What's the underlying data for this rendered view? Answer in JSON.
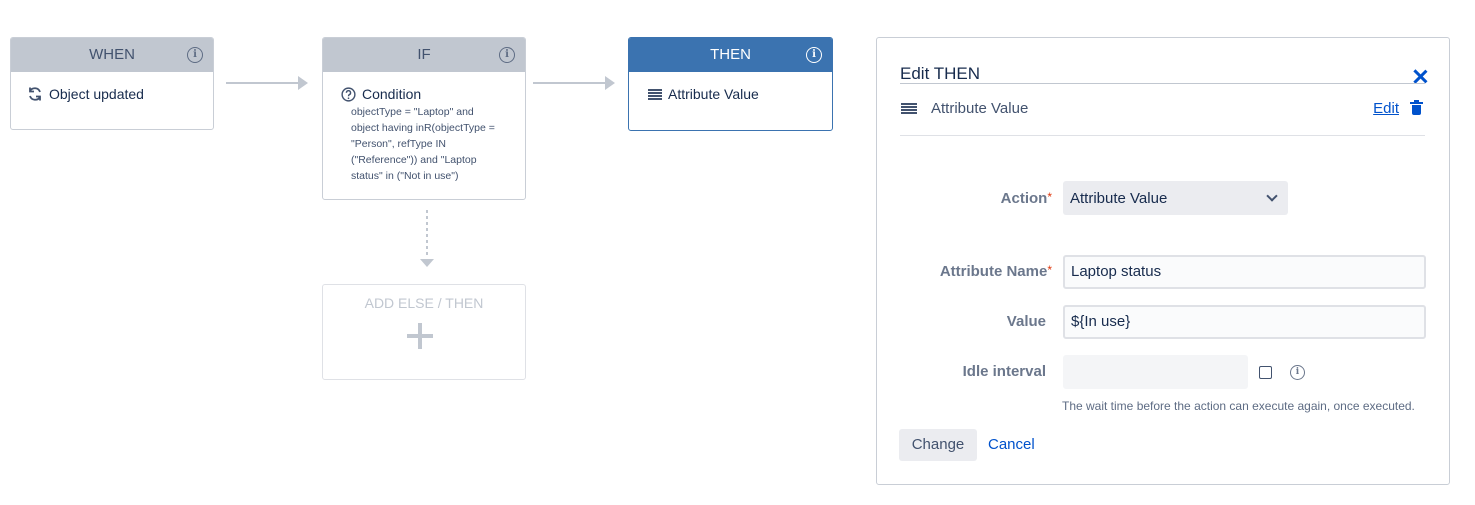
{
  "flow": {
    "when": {
      "title": "WHEN",
      "item": "Object updated"
    },
    "if": {
      "title": "IF",
      "item": "Condition",
      "condition_lines": [
        "objectType = \"Laptop\" and",
        "object having inR(objectType =",
        "\"Person\", refType IN",
        "(\"Reference\")) and \"Laptop",
        "status\" in (\"Not in use\")"
      ]
    },
    "then": {
      "title": "THEN",
      "item": "Attribute Value"
    },
    "else": {
      "label": "ADD ELSE / THEN"
    }
  },
  "panel": {
    "title": "Edit THEN",
    "attribute_row": "Attribute Value",
    "edit_label": "Edit",
    "form": {
      "action_label": "Action",
      "action_value": "Attribute Value",
      "attribute_name_label": "Attribute Name",
      "attribute_name_value": "Laptop status",
      "value_label": "Value",
      "value_value": "${In use}",
      "idle_label": "Idle interval",
      "idle_value": "",
      "helper": "The wait time before the action can execute again, once executed."
    },
    "change_label": "Change",
    "cancel_label": "Cancel"
  },
  "icons": {
    "info": "info-icon",
    "refresh": "refresh-icon",
    "question": "question-circle-icon",
    "menu": "list-icon",
    "close": "close-icon",
    "trash": "trash-icon",
    "plus": "plus-icon"
  },
  "colors": {
    "header_gray": "#c1c7d0",
    "header_blue": "#3b73b0",
    "link": "#0052cc",
    "required": "#de350b"
  }
}
